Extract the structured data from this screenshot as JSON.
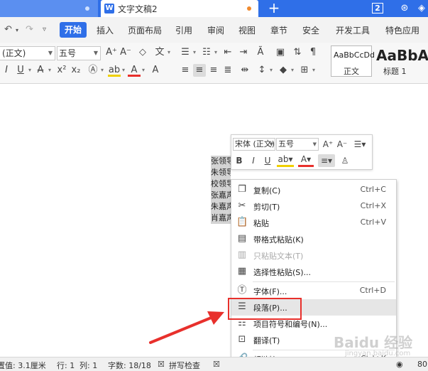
{
  "titlebar": {
    "doc_tab_title": "文字文稿2",
    "window_count": "2",
    "new_tab_label": "+",
    "app_icon_letter": "W"
  },
  "menubar": {
    "items": [
      "开始",
      "插入",
      "页面布局",
      "引用",
      "审阅",
      "视图",
      "章节",
      "安全",
      "开发工具",
      "特色应用"
    ],
    "active": "开始"
  },
  "ribbon": {
    "font_name": "(正文)",
    "font_size": "五号",
    "style_normal_preview": "AaBbCcDd",
    "style_normal_name": "正文",
    "style_h1_preview": "AaBbA",
    "style_h1_name": "标题 1"
  },
  "document": {
    "lines": [
      "张领导",
      "朱领导",
      "校领导",
      "张嘉声",
      "朱嘉声",
      "肖嘉声"
    ]
  },
  "mini_toolbar": {
    "font_name": "宋体 (正文)",
    "font_size": "五号"
  },
  "context_menu": {
    "items": [
      {
        "label": "复制(C)",
        "shortcut": "Ctrl+C",
        "icon": "copy-icon"
      },
      {
        "label": "剪切(T)",
        "shortcut": "Ctrl+X",
        "icon": "cut-icon"
      },
      {
        "label": "粘贴",
        "shortcut": "Ctrl+V",
        "icon": "paste-icon"
      },
      {
        "label": "带格式粘贴(K)",
        "shortcut": "",
        "icon": "paste-format-icon"
      },
      {
        "label": "只粘贴文本(T)",
        "shortcut": "",
        "icon": "paste-text-icon"
      },
      {
        "label": "选择性粘贴(S)...",
        "shortcut": "",
        "icon": "paste-special-icon"
      },
      {
        "label": "字体(F)...",
        "shortcut": "Ctrl+D",
        "icon": "font-icon"
      },
      {
        "label": "段落(P)...",
        "shortcut": "",
        "icon": "paragraph-icon"
      },
      {
        "label": "项目符号和编号(N)...",
        "shortcut": "",
        "icon": "bullets-icon"
      },
      {
        "label": "翻译(T)",
        "shortcut": "",
        "icon": "translate-icon"
      },
      {
        "label": "超链接(H)...",
        "shortcut": "Ctrl+K",
        "icon": "hyperlink-icon"
      }
    ],
    "highlighted": "段落(P)..."
  },
  "statusbar": {
    "position": "置值: 3.1厘米",
    "row": "行: 1",
    "col": "列: 1",
    "word_count": "字数: 18/18",
    "spell_check": "拼写检查",
    "zoom": "80"
  },
  "watermark": {
    "text": "Baidu 经验",
    "sub": "jingyan.baidu.com"
  },
  "colors": {
    "titlebar": "#2f6fe8",
    "annotation": "#e8302c"
  }
}
